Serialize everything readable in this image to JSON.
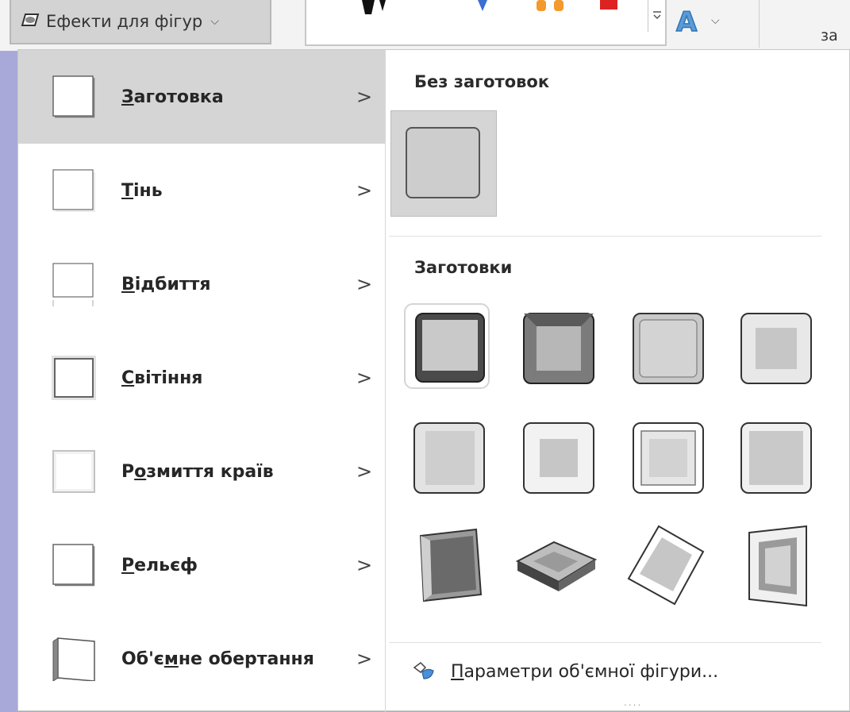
{
  "ribbon": {
    "effects_label": "Ефекти для фігур",
    "right_partial_text": "за"
  },
  "menu": {
    "items": [
      {
        "label_pre": "",
        "accel": "З",
        "label_post": "аготовка",
        "icon": "preset-effect-icon",
        "selected": true
      },
      {
        "label_pre": "",
        "accel": "Т",
        "label_post": "інь",
        "icon": "shadow-effect-icon",
        "selected": false
      },
      {
        "label_pre": "",
        "accel": "В",
        "label_post": "ідбиття",
        "icon": "reflection-effect-icon",
        "selected": false
      },
      {
        "label_pre": "",
        "accel": "С",
        "label_post": "вітіння",
        "icon": "glow-effect-icon",
        "selected": false
      },
      {
        "label_pre": "Р",
        "accel": "о",
        "label_post": "змиття країв",
        "icon": "soft-edges-icon",
        "selected": false
      },
      {
        "label_pre": "",
        "accel": "Р",
        "label_post": "ельєф",
        "icon": "bevel-effect-icon",
        "selected": false
      },
      {
        "label_pre": "Об'є",
        "accel": "м",
        "label_post": "не обертання",
        "icon": "3d-rotation-icon",
        "selected": false
      }
    ],
    "arrow_glyph": ">"
  },
  "submenu": {
    "no_presets_heading": "Без заготовок",
    "presets_heading": "Заготовки",
    "footer_accel": "П",
    "footer_rest": "араметри об'ємної фігури...",
    "grip": "....",
    "colors": {
      "dark_gray": "#555555",
      "mid_gray": "#c9c9c9",
      "light_gray": "#e6e6e6",
      "selected_bg": "#d5d5d5"
    }
  }
}
